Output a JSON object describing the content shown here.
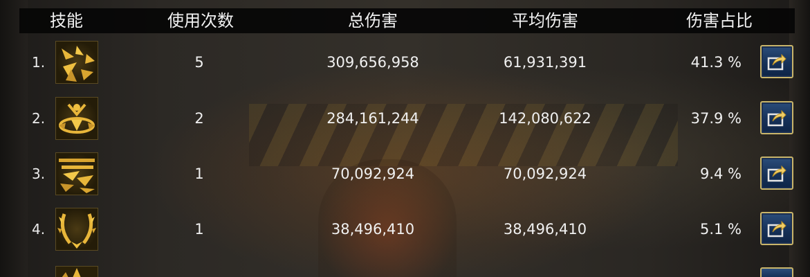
{
  "header": {
    "skill": "技能",
    "uses": "使用次数",
    "total_damage": "总伤害",
    "avg_damage": "平均伤害",
    "damage_share": "伤害占比"
  },
  "rows": [
    {
      "rank": "1.",
      "icon": "skill-icon-1",
      "uses": "5",
      "total": "309,656,958",
      "avg": "61,931,391",
      "share": "41.3 %"
    },
    {
      "rank": "2.",
      "icon": "skill-icon-2",
      "uses": "2",
      "total": "284,161,244",
      "avg": "142,080,622",
      "share": "37.9 %"
    },
    {
      "rank": "3.",
      "icon": "skill-icon-3",
      "uses": "1",
      "total": "70,092,924",
      "avg": "70,092,924",
      "share": "9.4 %"
    },
    {
      "rank": "4.",
      "icon": "skill-icon-4",
      "uses": "1",
      "total": "38,496,410",
      "avg": "38,496,410",
      "share": "5.1 %"
    }
  ],
  "colors": {
    "icon_gold": "#e8b63a",
    "button_blue": "#1b3a66",
    "button_border": "#c9b56a"
  },
  "icons": {
    "share_button": "share-export-icon"
  }
}
